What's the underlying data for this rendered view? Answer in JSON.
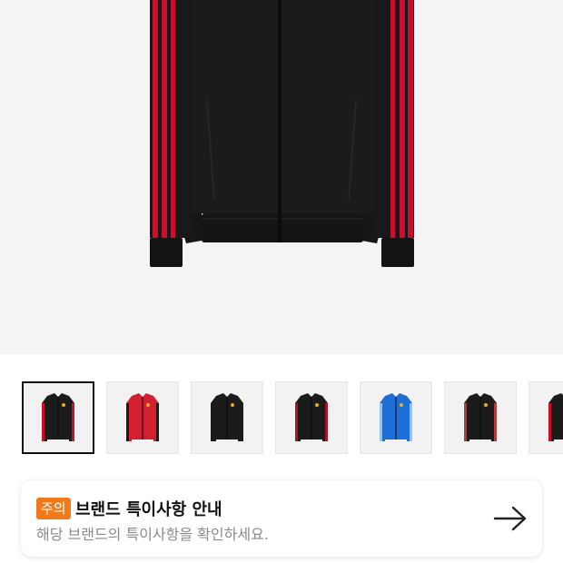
{
  "product_image": {
    "icon": "jacket-image"
  },
  "thumbnails": [
    {
      "name": "thumbnail-black-red-jacket",
      "selected": true,
      "body": "#1b1b1b",
      "stripe": "#c8102e"
    },
    {
      "name": "thumbnail-red-jacket",
      "selected": false,
      "body": "#d32030",
      "stripe": "#1b1b1b"
    },
    {
      "name": "thumbnail-black-gold-jacket",
      "selected": false,
      "body": "#1b1b1b",
      "stripe": "#1b1b1b"
    },
    {
      "name": "thumbnail-black-red-jacket-alt",
      "selected": false,
      "body": "#1b1b1b",
      "stripe": "#b0102a"
    },
    {
      "name": "thumbnail-blue-jacket",
      "selected": false,
      "body": "#1e6ed8",
      "stripe": "#8ec5f0"
    },
    {
      "name": "thumbnail-red-black-jacket",
      "selected": false,
      "body": "#1b1b1b",
      "stripe": "#b33a40"
    },
    {
      "name": "thumbnail-black-jacket",
      "selected": false,
      "body": "#1b1b1b",
      "stripe": "#c8102e"
    }
  ],
  "notice": {
    "badge": "주의",
    "title": "브랜드 특이사항 안내",
    "description": "해당 브랜드의 특이사항을 확인하세요.",
    "badge_color": "#f07a1a",
    "arrow_icon": "arrow-right-icon"
  }
}
